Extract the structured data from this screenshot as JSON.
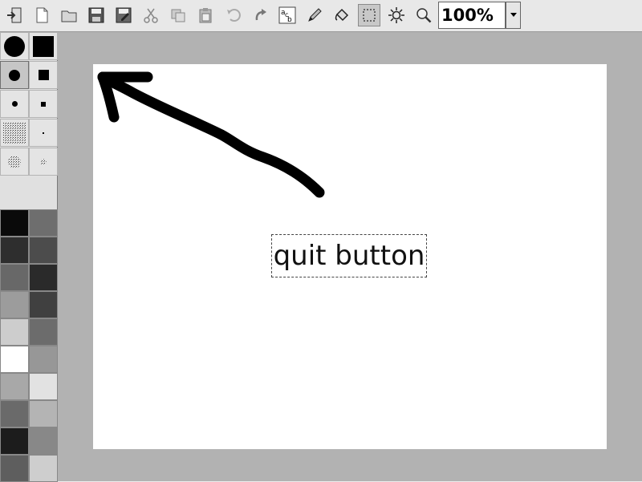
{
  "toolbar": {
    "tools": [
      {
        "name": "exit-icon"
      },
      {
        "name": "new-file-icon"
      },
      {
        "name": "open-folder-icon"
      },
      {
        "name": "save-icon"
      },
      {
        "name": "save-as-icon"
      },
      {
        "name": "cut-icon"
      },
      {
        "name": "copy-icon"
      },
      {
        "name": "paste-icon"
      },
      {
        "name": "undo-icon"
      },
      {
        "name": "redo-icon"
      },
      {
        "name": "text-tool-icon"
      },
      {
        "name": "pencil-icon"
      },
      {
        "name": "fill-bucket-icon"
      },
      {
        "name": "rect-select-icon"
      },
      {
        "name": "brightness-icon"
      },
      {
        "name": "zoom-icon"
      }
    ],
    "zoom_value": "100%"
  },
  "palette": {
    "brushes": [
      {
        "shape": "circle",
        "size": "large"
      },
      {
        "shape": "square",
        "size": "large"
      },
      {
        "shape": "circle",
        "size": "medium"
      },
      {
        "shape": "square",
        "size": "medium"
      },
      {
        "shape": "circle",
        "size": "small"
      },
      {
        "shape": "square",
        "size": "small"
      },
      {
        "shape": "spray",
        "size": "large"
      },
      {
        "shape": "dot",
        "size": "tiny"
      },
      {
        "shape": "spray",
        "size": "medium"
      },
      {
        "shape": "spray",
        "size": "small"
      }
    ],
    "current_color": "#070707",
    "colors_left": [
      "#0a0a0a",
      "#2e2e2e",
      "#686868",
      "#9c9c9c",
      "#cdcdcd",
      "#ffffff",
      "#a8a8a8",
      "#6a6a6a",
      "#1c1c1c",
      "#5e5e5e"
    ],
    "colors_right": [
      "#6e6e6e",
      "#4c4c4c",
      "#2a2a2a",
      "#404040",
      "#6c6c6c",
      "#979797",
      "#e2e2e2",
      "#b4b4b4",
      "#888888",
      "#cecece"
    ]
  },
  "canvas": {
    "annotation_text": "quit button",
    "stroke_color": "#000000"
  }
}
